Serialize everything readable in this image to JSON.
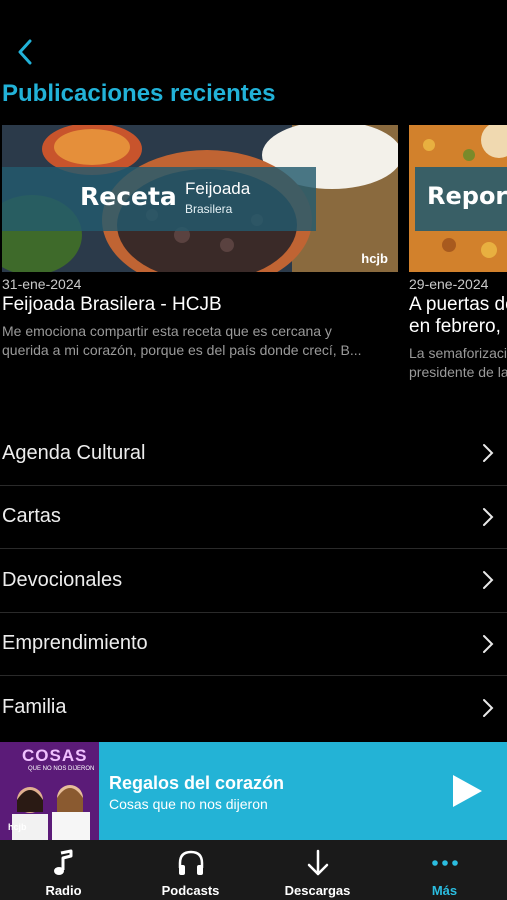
{
  "header": {
    "back_icon": "chevron-left-icon"
  },
  "section_title": "Publicaciones recientes",
  "posts": [
    {
      "banner_main": "Receta",
      "banner_sub1": "Feijoada",
      "banner_sub2": "Brasilera",
      "watermark": "hcjb",
      "date": "31-ene-2024",
      "title": "Feijoada Brasilera - HCJB",
      "excerpt_line1": "Me emociona compartir esta receta que es cercana y",
      "excerpt_line2": "querida a mi corazón, porque es del país donde crecí, B..."
    },
    {
      "banner_main": "Reportaje",
      "date": "29-ene-2024",
      "title_line1": "A puertas de iniciar clases",
      "title_line2": "en febrero,",
      "excerpt_line1": "La semaforización",
      "excerpt_line2": "presidente de la"
    }
  ],
  "menu": [
    {
      "label": "Agenda Cultural"
    },
    {
      "label": "Cartas"
    },
    {
      "label": "Devocionales"
    },
    {
      "label": "Emprendimiento"
    },
    {
      "label": "Familia"
    }
  ],
  "player": {
    "art_title": "COSAS",
    "art_subtitle": "QUE NO NOS DIJERON",
    "art_logo": "hcjb",
    "title": "Regalos del corazón",
    "subtitle": "Cosas que no nos dijeron",
    "play_icon": "play-icon"
  },
  "tabs": [
    {
      "label": "Radio",
      "icon": "music-note-icon",
      "active": false
    },
    {
      "label": "Podcasts",
      "icon": "headphones-icon",
      "active": false
    },
    {
      "label": "Descargas",
      "icon": "download-arrow-icon",
      "active": false
    },
    {
      "label": "Más",
      "icon": "more-dots-icon",
      "active": true
    }
  ],
  "colors": {
    "accent": "#23b3d6",
    "background": "#000000",
    "tabbar": "#1a1a1a"
  }
}
